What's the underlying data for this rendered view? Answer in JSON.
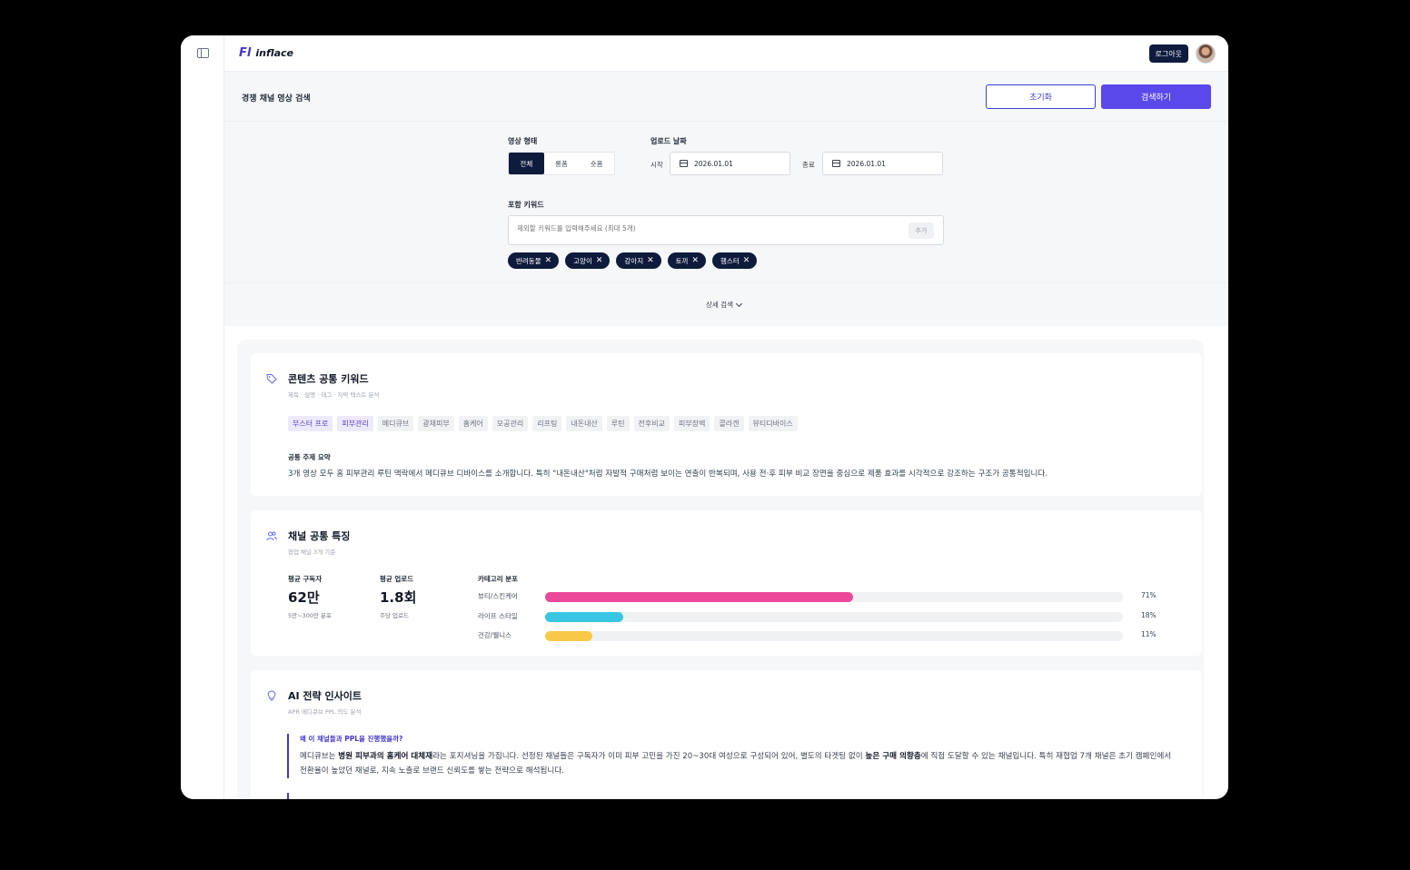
{
  "app": {
    "logo_mark": "Fl",
    "logo_text": "inflace"
  },
  "topbar": {
    "logout_label": "로그아웃"
  },
  "subheader": {
    "title": "경쟁 채널 영상 검색",
    "reset_label": "초기화",
    "search_label": "검색하기"
  },
  "filters": {
    "video_type_label": "영상 형태",
    "video_types": [
      "전체",
      "롱폼",
      "숏폼"
    ],
    "video_type_selected": "전체",
    "upload_date_label": "업로드 날짜",
    "start_label": "시작",
    "start_date": "2026.01.01",
    "end_label": "종료",
    "end_date": "2026.01.01",
    "keyword_label": "포함 키워드",
    "keyword_placeholder": "제외할 키워드를 입력해주세요 (최대 5개)",
    "keyword_add_label": "추가",
    "keywords": [
      "반려동물",
      "고양이",
      "강아지",
      "토끼",
      "햄스터"
    ],
    "advanced_label": "상세 검색"
  },
  "keywords_card": {
    "title": "콘텐츠 공통 키워드",
    "subtitle": "제목 · 설명 · 태그 · 자막 텍스트 분석",
    "tags": [
      {
        "text": "부스터 프로",
        "highlight": true
      },
      {
        "text": "피부관리",
        "highlight": true
      },
      {
        "text": "메디큐브",
        "highlight": false
      },
      {
        "text": "광채피부",
        "highlight": false
      },
      {
        "text": "홈케어",
        "highlight": false
      },
      {
        "text": "모공관리",
        "highlight": false
      },
      {
        "text": "리프팅",
        "highlight": false
      },
      {
        "text": "내돈내산",
        "highlight": false
      },
      {
        "text": "루틴",
        "highlight": false
      },
      {
        "text": "전후비교",
        "highlight": false
      },
      {
        "text": "피부장벽",
        "highlight": false
      },
      {
        "text": "콜라겐",
        "highlight": false
      },
      {
        "text": "뷰티디바이스",
        "highlight": false
      }
    ],
    "summary_label": "공통 주제 요약",
    "summary_text": "3개 영상 모두 홈 피부관리 루틴 맥락에서 메디큐브 디바이스를 소개합니다. 특히 \"내돈내산\"처럼 자발적 구매처럼 보이는 연출이 반복되며, 사용 전·후 피부 비교 장면을 중심으로 제품 효과를 시각적으로 강조하는 구조가 공통적입니다."
  },
  "channel_card": {
    "title": "채널 공통 특징",
    "subtitle": "협업 채널 3개 기준",
    "subscribers_label": "평균 구독자",
    "subscribers_value": "62만",
    "subscribers_note": "5만~300만 분포",
    "uploads_label": "평균 업로드",
    "uploads_value": "1.8회",
    "uploads_note": "주당 업로드",
    "category_label": "카테고리 분포",
    "categories": [
      {
        "name": "뷰티/스킨케어",
        "percent": 71,
        "pct_label": "71%",
        "color": "#ec4899"
      },
      {
        "name": "라이프 스타일",
        "percent": 18,
        "pct_label": "18%",
        "color": "#38c6e3"
      },
      {
        "name": "건강/웰니스",
        "percent": 11,
        "pct_label": "11%",
        "color": "#f7c948"
      }
    ]
  },
  "insight_card": {
    "title": "AI 전략 인사이트",
    "subtitle": "APR 메디큐브 PPL 의도 분석",
    "question": "왜 이 채널들과 PPL을 진행했을까?",
    "p_a": "메디큐브는 ",
    "p_b1": "병원 피부과의 홈케어 대체재",
    "p_c": "라는 포지셔닝을 가집니다. 선정된 채널들은 구독자가 이미 피부 고민을 가진 20~30대 여성으로 구성되어 있어, 별도의 타겟팅 없이 ",
    "p_b2": "높은 구매 의향층",
    "p_d": "에 직접 도달할 수 있는 채널입니다. 특히 재협업 7개 채널은 초기 캠페인에서 전환율이 높았던 채널로, 지속 노출로 브랜드 신뢰도를 쌓는 전략으로 해석됩니다."
  },
  "colors": {
    "navy": "#0f1b3d",
    "primary": "#5b48ea",
    "accent": "#4338ca"
  },
  "icons": [
    "panel-toggle-icon",
    "calendar-icon",
    "close-icon",
    "chevron-down-icon",
    "tag-icon",
    "users-icon",
    "lightbulb-icon"
  ]
}
